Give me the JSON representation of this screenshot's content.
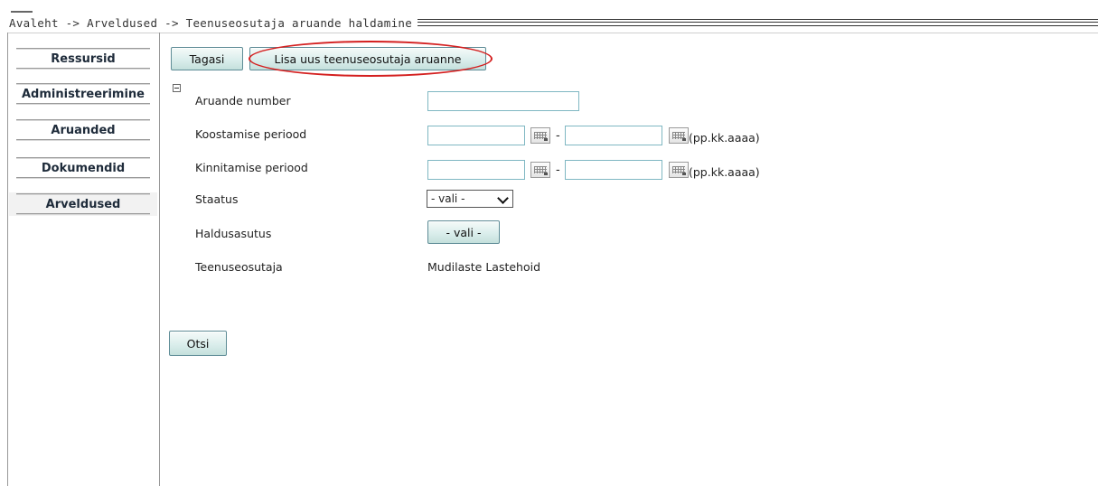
{
  "breadcrumb": "Avaleht -> Arveldused -> Teenuseosutaja aruande haldamine",
  "sidebar": {
    "items": [
      {
        "label": "Ressursid"
      },
      {
        "label": "Administreerimine"
      },
      {
        "label": "Aruanded"
      },
      {
        "label": "Dokumendid"
      },
      {
        "label": "Arveldused",
        "active": true
      }
    ]
  },
  "toolbar": {
    "back_label": "Tagasi",
    "add_report_label": "Lisa uus teenuseosutaja aruanne"
  },
  "form": {
    "report_number": {
      "label": "Aruande number",
      "value": ""
    },
    "compile_period": {
      "label": "Koostamise periood",
      "from": "",
      "to": "",
      "separator": "-",
      "format_hint": "(pp.kk.aaaa)"
    },
    "confirm_period": {
      "label": "Kinnitamise periood",
      "from": "",
      "to": "",
      "separator": "-",
      "format_hint": "(pp.kk.aaaa)"
    },
    "status": {
      "label": "Staatus",
      "selected": "- vali -"
    },
    "admin_authority": {
      "label": "Haldusasutus",
      "button_label": "- vali -"
    },
    "service_provider": {
      "label": "Teenuseosutaja",
      "value": "Mudilaste Lastehoid"
    }
  },
  "search_button_label": "Otsi",
  "colors": {
    "highlight": "#d42020",
    "button_border": "#5e8c96",
    "input_border": "#7fb7c2"
  }
}
